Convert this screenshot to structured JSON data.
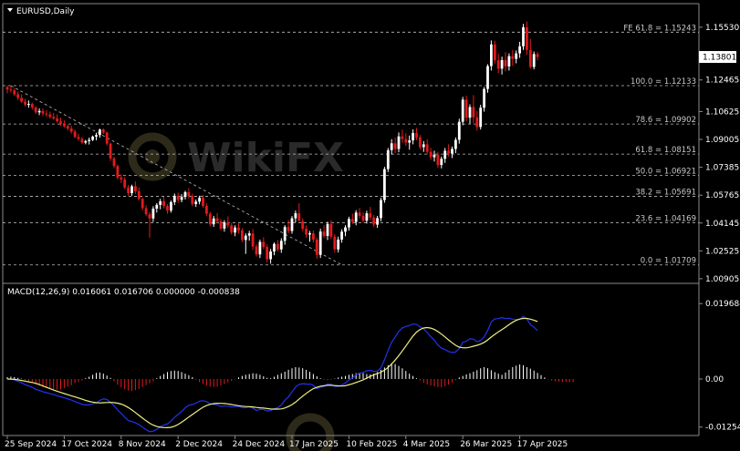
{
  "header": {
    "menu_icon": "dropdown-triangle-icon",
    "title": "EURUSD,Daily"
  },
  "indicator": {
    "label": "MACD(12,26,9) 0.016061 0.016706 0.000000 -0.000838"
  },
  "watermark": {
    "text": "WikiFX"
  },
  "colors": {
    "background": "#000000",
    "up": "#ffffff",
    "down": "#e31a1c",
    "macd_line": "#2233ee",
    "signal_line": "#eeee88",
    "price_label_bg": "#ffffff"
  },
  "chart_data": [
    {
      "type": "candlestick",
      "title": "EURUSD,Daily",
      "ylim": [
        1.009,
        1.1616
      ],
      "price_ticks": [
        "1.15530",
        "1.12465",
        "1.10625",
        "1.09005",
        "1.07385",
        "1.05765",
        "1.04145",
        "1.02525",
        "1.00905"
      ],
      "current_price": "1.13801",
      "levels": [
        {
          "label": "FE 61.8 = 1.15243",
          "value": 1.15243
        },
        {
          "label": "100.0 = 1.12133",
          "value": 1.12133
        },
        {
          "label": "78.6 = 1.09902",
          "value": 1.09902
        },
        {
          "label": "61.8 = 1.08151",
          "value": 1.08151
        },
        {
          "label": "50.0 = 1.06921",
          "value": 1.06921
        },
        {
          "label": "38.2 = 1.05691",
          "value": 1.05691
        },
        {
          "label": "23.6 = 1.04169",
          "value": 1.04169
        },
        {
          "label": "0.0 = 1.01709",
          "value": 1.01709
        }
      ],
      "trendline": [
        [
          1.1213,
          1.0171
        ]
      ],
      "date_labels": [
        "25 Sep 2024",
        "17 Oct 2024",
        "8 Nov 2024",
        "2 Dec 2024",
        "24 Dec 2024",
        "17 Jan 2025",
        "10 Feb 2025",
        "4 Mar 2025",
        "26 Mar 2025",
        "17 Apr 2025"
      ],
      "date_label_bars": [
        0,
        16,
        32,
        48,
        64,
        80,
        96,
        112,
        128,
        144
      ],
      "ohlc": [
        [
          1.1205,
          1.1215,
          1.1169,
          1.1191
        ],
        [
          1.1191,
          1.1209,
          1.1173,
          1.1186
        ],
        [
          1.1186,
          1.1198,
          1.1154,
          1.1163
        ],
        [
          1.1163,
          1.1179,
          1.1129,
          1.1142
        ],
        [
          1.1142,
          1.1162,
          1.1113,
          1.112
        ],
        [
          1.112,
          1.1137,
          1.1092,
          1.1103
        ],
        [
          1.1103,
          1.1127,
          1.1085,
          1.1107
        ],
        [
          1.1107,
          1.1115,
          1.1074,
          1.1086
        ],
        [
          1.1086,
          1.1094,
          1.1049,
          1.1058
        ],
        [
          1.1058,
          1.1081,
          1.1042,
          1.1066
        ],
        [
          1.1066,
          1.108,
          1.1036,
          1.1051
        ],
        [
          1.1051,
          1.107,
          1.1033,
          1.1046
        ],
        [
          1.1046,
          1.1062,
          1.1021,
          1.1032
        ],
        [
          1.1032,
          1.1055,
          1.1014,
          1.1023
        ],
        [
          1.1023,
          1.1046,
          1.0999,
          1.1006
        ],
        [
          1.1006,
          1.1027,
          1.098,
          1.0991
        ],
        [
          1.0991,
          1.1012,
          1.0969,
          1.0978
        ],
        [
          1.0978,
          1.0986,
          1.0952,
          1.0964
        ],
        [
          1.0964,
          1.098,
          1.0934,
          1.0946
        ],
        [
          1.0946,
          1.0958,
          1.0907,
          1.0915
        ],
        [
          1.0915,
          1.0933,
          1.0893,
          1.0904
        ],
        [
          1.0904,
          1.0914,
          1.0874,
          1.0882
        ],
        [
          1.0882,
          1.0898,
          1.0872,
          1.0891
        ],
        [
          1.0891,
          1.0911,
          1.0871,
          1.0898
        ],
        [
          1.0898,
          1.0923,
          1.0891,
          1.0917
        ],
        [
          1.0917,
          1.0939,
          1.0896,
          1.0926
        ],
        [
          1.0926,
          1.0963,
          1.0911,
          1.0958
        ],
        [
          1.0958,
          1.0965,
          1.0932,
          1.0941
        ],
        [
          1.0941,
          1.0945,
          1.0865,
          1.0876
        ],
        [
          1.0876,
          1.0882,
          1.0775,
          1.079
        ],
        [
          1.079,
          1.08,
          1.0734,
          1.0746
        ],
        [
          1.0746,
          1.0755,
          1.0666,
          1.0679
        ],
        [
          1.0679,
          1.0697,
          1.0647,
          1.0668
        ],
        [
          1.0668,
          1.0683,
          1.0611,
          1.0621
        ],
        [
          1.0621,
          1.0636,
          1.0572,
          1.0588
        ],
        [
          1.0588,
          1.0637,
          1.0573,
          1.0628
        ],
        [
          1.0628,
          1.0656,
          1.0584,
          1.0599
        ],
        [
          1.0599,
          1.0622,
          1.0546,
          1.0555
        ],
        [
          1.0555,
          1.0561,
          1.0488,
          1.0501
        ],
        [
          1.0501,
          1.0518,
          1.0454,
          1.0466
        ],
        [
          1.0466,
          1.0478,
          1.0329,
          1.0441
        ],
        [
          1.0441,
          1.0512,
          1.0421,
          1.0498
        ],
        [
          1.0498,
          1.053,
          1.0475,
          1.052
        ],
        [
          1.052,
          1.0555,
          1.0494,
          1.0541
        ],
        [
          1.0541,
          1.0566,
          1.0499,
          1.0513
        ],
        [
          1.0513,
          1.0524,
          1.0468,
          1.0487
        ],
        [
          1.0487,
          1.0545,
          1.0475,
          1.0536
        ],
        [
          1.0536,
          1.0586,
          1.0519,
          1.0573
        ],
        [
          1.0573,
          1.0591,
          1.0531,
          1.0549
        ],
        [
          1.0549,
          1.0582,
          1.0535,
          1.0566
        ],
        [
          1.0566,
          1.0602,
          1.0551,
          1.0594
        ],
        [
          1.0594,
          1.0618,
          1.0557,
          1.0571
        ],
        [
          1.0571,
          1.0585,
          1.0512,
          1.0525
        ],
        [
          1.0525,
          1.0551,
          1.0508,
          1.0539
        ],
        [
          1.0539,
          1.0573,
          1.0523,
          1.0561
        ],
        [
          1.0561,
          1.0578,
          1.0503,
          1.0514
        ],
        [
          1.0514,
          1.0529,
          1.0455,
          1.0468
        ],
        [
          1.0468,
          1.048,
          1.0395,
          1.0407
        ],
        [
          1.0407,
          1.0456,
          1.0392,
          1.0441
        ],
        [
          1.0441,
          1.0472,
          1.0411,
          1.0425
        ],
        [
          1.0425,
          1.0438,
          1.0371,
          1.0382
        ],
        [
          1.0382,
          1.0431,
          1.0364,
          1.0418
        ],
        [
          1.0418,
          1.0453,
          1.0387,
          1.0401
        ],
        [
          1.0401,
          1.0416,
          1.0347,
          1.0359
        ],
        [
          1.0359,
          1.0401,
          1.0338,
          1.0388
        ],
        [
          1.0388,
          1.0412,
          1.0352,
          1.0371
        ],
        [
          1.0371,
          1.0385,
          1.0303,
          1.0316
        ],
        [
          1.0316,
          1.0354,
          1.0235,
          1.0341
        ],
        [
          1.0341,
          1.0369,
          1.0312,
          1.0354
        ],
        [
          1.0354,
          1.038,
          1.0257,
          1.0278
        ],
        [
          1.0278,
          1.0291,
          1.0219,
          1.0232
        ],
        [
          1.0232,
          1.0318,
          1.0211,
          1.0305
        ],
        [
          1.0305,
          1.0332,
          1.0262,
          1.0275
        ],
        [
          1.0275,
          1.029,
          1.0185,
          1.0204
        ],
        [
          1.0204,
          1.0264,
          1.0178,
          1.0249
        ],
        [
          1.0249,
          1.0301,
          1.0227,
          1.0293
        ],
        [
          1.0293,
          1.0315,
          1.0248,
          1.0261
        ],
        [
          1.0261,
          1.0326,
          1.0241,
          1.0311
        ],
        [
          1.0311,
          1.0402,
          1.0288,
          1.0391
        ],
        [
          1.0391,
          1.0432,
          1.0355,
          1.0368
        ],
        [
          1.0368,
          1.0455,
          1.0352,
          1.0442
        ],
        [
          1.0442,
          1.0487,
          1.0418,
          1.0471
        ],
        [
          1.0471,
          1.053,
          1.0448,
          1.0426
        ],
        [
          1.0426,
          1.0441,
          1.0367,
          1.0381
        ],
        [
          1.0381,
          1.04,
          1.0329,
          1.0347
        ],
        [
          1.0347,
          1.0368,
          1.0306,
          1.0355
        ],
        [
          1.0355,
          1.0371,
          1.0301,
          1.0318
        ],
        [
          1.0318,
          1.0331,
          1.0207,
          1.0229
        ],
        [
          1.0229,
          1.0382,
          1.0211,
          1.0365
        ],
        [
          1.0365,
          1.0401,
          1.0327,
          1.0339
        ],
        [
          1.0339,
          1.0421,
          1.0315,
          1.0409
        ],
        [
          1.0409,
          1.043,
          1.0321,
          1.0335
        ],
        [
          1.0335,
          1.0349,
          1.0242,
          1.0261
        ],
        [
          1.0261,
          1.0335,
          1.0243,
          1.0318
        ],
        [
          1.0318,
          1.0378,
          1.03,
          1.0364
        ],
        [
          1.0364,
          1.0401,
          1.0338,
          1.0389
        ],
        [
          1.0389,
          1.0451,
          1.037,
          1.0438
        ],
        [
          1.0438,
          1.0469,
          1.0407,
          1.0421
        ],
        [
          1.0421,
          1.0489,
          1.0401,
          1.0475
        ],
        [
          1.0475,
          1.0502,
          1.0441,
          1.0456
        ],
        [
          1.0456,
          1.0478,
          1.0415,
          1.0428
        ],
        [
          1.0428,
          1.0486,
          1.0411,
          1.0471
        ],
        [
          1.0471,
          1.0508,
          1.0432,
          1.0447
        ],
        [
          1.0447,
          1.0461,
          1.0391,
          1.0405
        ],
        [
          1.0405,
          1.0456,
          1.0386,
          1.0443
        ],
        [
          1.0443,
          1.0561,
          1.0425,
          1.0548
        ],
        [
          1.0548,
          1.0741,
          1.0532,
          1.0728
        ],
        [
          1.0728,
          1.0851,
          1.0711,
          1.0838
        ],
        [
          1.0838,
          1.0902,
          1.0812,
          1.0878
        ],
        [
          1.0878,
          1.0912,
          1.0821,
          1.0845
        ],
        [
          1.0845,
          1.0941,
          1.0826,
          1.0918
        ],
        [
          1.0918,
          1.0958,
          1.0881,
          1.0903
        ],
        [
          1.0903,
          1.0937,
          1.0862,
          1.0882
        ],
        [
          1.0882,
          1.0923,
          1.0841,
          1.0895
        ],
        [
          1.0895,
          1.0959,
          1.0872,
          1.0938
        ],
        [
          1.0938,
          1.0967,
          1.0897,
          1.0912
        ],
        [
          1.0912,
          1.0926,
          1.0842,
          1.0856
        ],
        [
          1.0856,
          1.0891,
          1.0828,
          1.0872
        ],
        [
          1.0872,
          1.0902,
          1.0815,
          1.0828
        ],
        [
          1.0828,
          1.0852,
          1.0781,
          1.0797
        ],
        [
          1.0797,
          1.0835,
          1.0772,
          1.0812
        ],
        [
          1.0812,
          1.0828,
          1.0735,
          1.0752
        ],
        [
          1.0752,
          1.0801,
          1.0732,
          1.0788
        ],
        [
          1.0788,
          1.0851,
          1.0764,
          1.0835
        ],
        [
          1.0835,
          1.0872,
          1.0801,
          1.0818
        ],
        [
          1.0818,
          1.0859,
          1.0792,
          1.0845
        ],
        [
          1.0845,
          1.0912,
          1.0821,
          1.0898
        ],
        [
          1.0898,
          1.1021,
          1.0876,
          1.1003
        ],
        [
          1.1003,
          1.1148,
          1.0983,
          1.1132
        ],
        [
          1.1132,
          1.1155,
          1.1005,
          1.1027
        ],
        [
          1.1027,
          1.1105,
          1.0992,
          1.1089
        ],
        [
          1.1089,
          1.1158,
          1.0997,
          1.1029
        ],
        [
          1.1029,
          1.1065,
          1.0951,
          1.0973
        ],
        [
          1.0973,
          1.1102,
          1.0958,
          1.1085
        ],
        [
          1.1085,
          1.1205,
          1.1062,
          1.1194
        ],
        [
          1.1194,
          1.1338,
          1.1172,
          1.1327
        ],
        [
          1.1327,
          1.1476,
          1.1301,
          1.1453
        ],
        [
          1.1453,
          1.1475,
          1.1342,
          1.1361
        ],
        [
          1.1361,
          1.1398,
          1.1285,
          1.1312
        ],
        [
          1.1312,
          1.1382,
          1.1278,
          1.1362
        ],
        [
          1.1362,
          1.1408,
          1.1296,
          1.1325
        ],
        [
          1.1325,
          1.1401,
          1.1301,
          1.1385
        ],
        [
          1.1385,
          1.1421,
          1.1328,
          1.1369
        ],
        [
          1.1369,
          1.1418,
          1.1343,
          1.1401
        ],
        [
          1.1401,
          1.1468,
          1.1375,
          1.1442
        ],
        [
          1.1442,
          1.1572,
          1.1421,
          1.1553
        ],
        [
          1.1553,
          1.1586,
          1.1392,
          1.1421
        ],
        [
          1.1421,
          1.1485,
          1.1312,
          1.1322
        ],
        [
          1.1322,
          1.1412,
          1.1308,
          1.1397
        ],
        [
          1.1397,
          1.141,
          1.1361,
          1.138
        ]
      ]
    },
    {
      "type": "macd",
      "title": "MACD(12,26,9) 0.016061 0.016706 0.000000 -0.000838",
      "ylim": [
        -0.0138,
        0.0214
      ],
      "ticks": [
        "0.019684",
        "0.00",
        "-0.012547"
      ],
      "histogram": [
        0.0005,
        0.0006,
        0.0005,
        0.0003,
        0.0001,
        -0.0003,
        -0.0007,
        -0.001,
        -0.0015,
        -0.0017,
        -0.0021,
        -0.0024,
        -0.0026,
        -0.0027,
        -0.0028,
        -0.0027,
        -0.0024,
        -0.002,
        -0.0016,
        -0.0011,
        -0.0008,
        -0.0004,
        0.0002,
        0.0006,
        0.0011,
        0.0016,
        0.0017,
        0.0014,
        0.0009,
        0.0003,
        -0.0006,
        -0.0015,
        -0.0022,
        -0.0027,
        -0.003,
        -0.0031,
        -0.0029,
        -0.0026,
        -0.0021,
        -0.0016,
        -0.0011,
        -0.0006,
        0.0002,
        0.0008,
        0.0013,
        0.0018,
        0.0021,
        0.0022,
        0.0021,
        0.0018,
        0.0014,
        0.001,
        0.0005,
        -0.0002,
        -0.0008,
        -0.0013,
        -0.0017,
        -0.002,
        -0.0021,
        -0.002,
        -0.0017,
        -0.0013,
        -0.0009,
        -0.0005,
        -0.0001,
        0.0004,
        0.0008,
        0.0011,
        0.0013,
        0.0015,
        0.0014,
        0.0011,
        0.0007,
        0.0003,
        0.0002,
        0.0006,
        0.0011,
        0.0015,
        0.0019,
        0.0024,
        0.0028,
        0.0031,
        0.003,
        0.0028,
        0.0024,
        0.0019,
        0.0013,
        0.0007,
        0.0002,
        -0.0002,
        -0.0003,
        -0.0002,
        0.0001,
        0.0004,
        0.0006,
        0.0008,
        0.0011,
        0.0013,
        0.0015,
        0.0016,
        0.0015,
        0.0013,
        0.0012,
        0.0014,
        0.0018,
        0.0024,
        0.003,
        0.0036,
        0.0041,
        0.0039,
        0.0034,
        0.0028,
        0.0021,
        0.0014,
        0.0008,
        0.0002,
        -0.0004,
        -0.001,
        -0.0014,
        -0.0017,
        -0.0019,
        -0.0021,
        -0.0022,
        -0.0019,
        -0.0015,
        -0.0009,
        -0.0003,
        0.0004,
        0.0008,
        0.0012,
        0.0015,
        0.0019,
        0.0023,
        0.0028,
        0.0031,
        0.0028,
        0.0023,
        0.0018,
        0.0014,
        0.0011,
        0.0017,
        0.0024,
        0.0031,
        0.0035,
        0.0038,
        0.0036,
        0.0031,
        0.0027,
        0.0022,
        0.0016,
        0.001,
        0.0004,
        -0.0001,
        -0.0004,
        -0.0006,
        -0.0007,
        -0.0008,
        -0.0008,
        -0.0008,
        -0.0008
      ]
    }
  ]
}
